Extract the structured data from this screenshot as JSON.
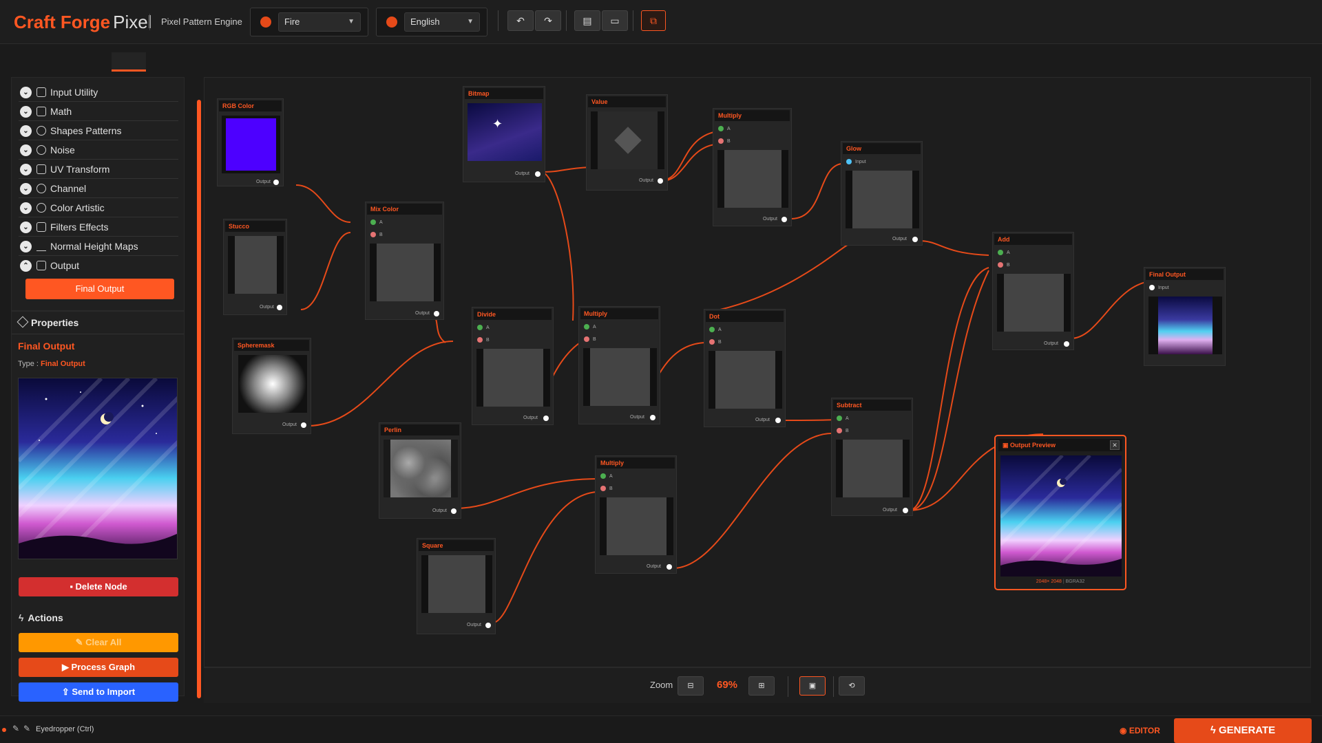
{
  "app": {
    "brand_bold": "Craft Forge",
    "brand_light": "Pixel",
    "subtitle": "Pixel Pattern Engine"
  },
  "toolbar": {
    "theme_value": "Fire",
    "language_value": "English",
    "undo_icon": "undo-icon",
    "redo_icon": "redo-icon",
    "save_icon": "save-icon",
    "open_icon": "folder-icon",
    "window_icon": "window-icon"
  },
  "sidebar": {
    "categories": [
      {
        "label": "Input Utility",
        "icon": "upload-icon",
        "expanded": false
      },
      {
        "label": "Math",
        "icon": "grid-icon",
        "expanded": false
      },
      {
        "label": "Shapes Patterns",
        "icon": "palette-icon",
        "expanded": false
      },
      {
        "label": "Noise",
        "icon": "noise-icon",
        "expanded": false
      },
      {
        "label": "UV  Transform",
        "icon": "transform-icon",
        "expanded": false
      },
      {
        "label": "Channel",
        "icon": "channel-icon",
        "expanded": false
      },
      {
        "label": "Color  Artistic",
        "icon": "color-icon",
        "expanded": false
      },
      {
        "label": "Filters  Effects",
        "icon": "filter-icon",
        "expanded": false
      },
      {
        "label": "Normal  Height Maps",
        "icon": "mountain-icon",
        "expanded": false
      },
      {
        "label": "Output",
        "icon": "output-icon",
        "expanded": true
      }
    ],
    "output_item": "Final Output"
  },
  "properties": {
    "header": "Properties",
    "node_title": "Final Output",
    "type_label": "Type :",
    "type_value": "Final Output",
    "delete_label": "Delete Node"
  },
  "actions": {
    "header": "Actions",
    "clear_all": "Clear All",
    "process_graph": "Process Graph",
    "send_import": "Send to Import"
  },
  "nodes": {
    "rgb": {
      "title": "RGB Color",
      "out": "Output",
      "color": "#4d00ff"
    },
    "stucco": {
      "title": "Stucco",
      "out": "Output"
    },
    "spheremask": {
      "title": "Spheremask",
      "out": "Output"
    },
    "mixcolor": {
      "title": "Mix Color",
      "a": "A",
      "b": "B",
      "out": "Output"
    },
    "bitmap": {
      "title": "Bitmap",
      "out": "Output"
    },
    "perlin": {
      "title": "Perlin",
      "out": "Output"
    },
    "square": {
      "title": "Square",
      "out": "Output"
    },
    "value": {
      "title": "Value",
      "out": "Output"
    },
    "divide": {
      "title": "Divide",
      "a": "A",
      "b": "B",
      "out": "Output"
    },
    "multiply1": {
      "title": "Multiply",
      "a": "A",
      "b": "B",
      "out": "Output"
    },
    "multiply2": {
      "title": "Multiply",
      "a": "A",
      "b": "B",
      "out": "Output"
    },
    "multiply3": {
      "title": "Multiply",
      "a": "A",
      "b": "B",
      "out": "Output"
    },
    "dot": {
      "title": "Dot",
      "a": "A",
      "b": "B",
      "out": "Output"
    },
    "glow": {
      "title": "Glow",
      "in": "Input",
      "out": "Output"
    },
    "subtract": {
      "title": "Subtract",
      "a": "A",
      "b": "B",
      "out": "Output"
    },
    "add": {
      "title": "Add",
      "a": "A",
      "b": "B",
      "out": "Output"
    },
    "final": {
      "title": "Final Output",
      "in": "Input"
    }
  },
  "output_preview": {
    "title": "Output Preview",
    "size": "2048× 2048",
    "format": "BGRA32"
  },
  "zoom": {
    "label": "Zoom",
    "value": "69%"
  },
  "status": {
    "tool": "Eyedropper (Ctrl)",
    "mode": "EDITOR",
    "generate": "GENERATE"
  },
  "colors": {
    "accent": "#ff5722",
    "wire": "#e64a19",
    "danger": "#d32f2f",
    "warning": "#ff9800",
    "info": "#2962ff"
  }
}
